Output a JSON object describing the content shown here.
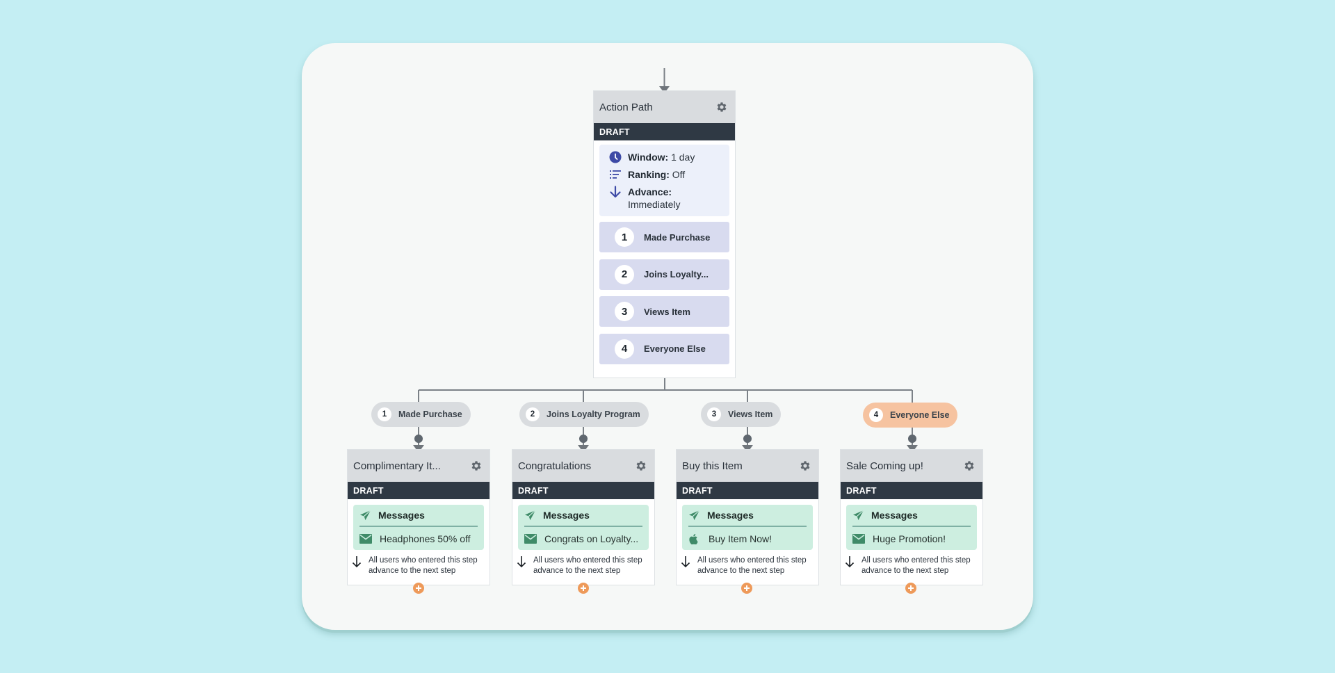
{
  "colors": {
    "background": "#c4eef3",
    "canvas": "#f6f8f7",
    "card_header": "#d9dcdf",
    "draft_bar": "#2f3944",
    "settings_box": "#ecf0fa",
    "path_item": "#d8dbef",
    "message_box": "#cdeee0",
    "active_pill": "#f6c3a0",
    "add_button": "#ee9a5a",
    "icon_blue": "#3d4aa6",
    "icon_green": "#3f8b68"
  },
  "action_path": {
    "title": "Action Path",
    "status": "DRAFT",
    "settings": [
      {
        "icon": "clock-icon",
        "label": "Window:",
        "value": "1 day"
      },
      {
        "icon": "ranking-list-icon",
        "label": "Ranking:",
        "value": "Off"
      },
      {
        "icon": "arrow-down-icon",
        "label": "Advance:",
        "value": "Immediately"
      }
    ],
    "paths": [
      {
        "number": "1",
        "label": "Made Purchase"
      },
      {
        "number": "2",
        "label": "Joins Loyalty..."
      },
      {
        "number": "3",
        "label": "Views Item"
      },
      {
        "number": "4",
        "label": "Everyone Else"
      }
    ]
  },
  "branches": [
    {
      "number": "1",
      "label": "Made Purchase",
      "active": false,
      "step": {
        "title": "Complimentary It...",
        "status": "DRAFT",
        "section": "Messages",
        "message": {
          "channel_icon": "email-icon",
          "text": "Headphones 50% off"
        },
        "advance_note": "All users who entered this step advance to the next step"
      }
    },
    {
      "number": "2",
      "label": "Joins Loyalty Program",
      "active": false,
      "step": {
        "title": "Congratulations",
        "status": "DRAFT",
        "section": "Messages",
        "message": {
          "channel_icon": "email-icon",
          "text": "Congrats on Loyalty..."
        },
        "advance_note": "All users who entered this step advance to the next step"
      }
    },
    {
      "number": "3",
      "label": "Views Item",
      "active": false,
      "step": {
        "title": "Buy this Item",
        "status": "DRAFT",
        "section": "Messages",
        "message": {
          "channel_icon": "apple-icon",
          "text": "Buy Item Now!"
        },
        "advance_note": "All users who entered this step advance to the next step"
      }
    },
    {
      "number": "4",
      "label": "Everyone Else",
      "active": true,
      "step": {
        "title": "Sale Coming up!",
        "status": "DRAFT",
        "section": "Messages",
        "message": {
          "channel_icon": "email-icon",
          "text": "Huge Promotion!"
        },
        "advance_note": "All users who entered this step advance to the next step"
      }
    }
  ]
}
